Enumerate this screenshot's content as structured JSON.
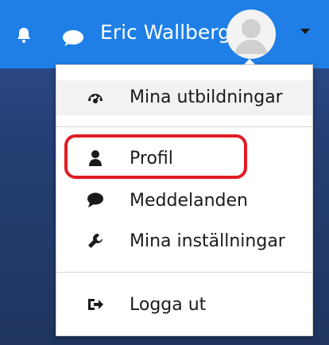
{
  "header": {
    "user_name": "Eric Wallberg",
    "icons": {
      "notifications": "bell-icon",
      "messages": "chat-icon",
      "avatar": "user-avatar-icon",
      "dropdown": "caret-down-icon"
    }
  },
  "menu": {
    "items": [
      {
        "label": "Mina utbildningar",
        "icon": "dashboard-icon"
      },
      {
        "label": "Profil",
        "icon": "user-icon"
      },
      {
        "label": "Meddelanden",
        "icon": "speech-bubble-icon"
      },
      {
        "label": "Mina inställningar",
        "icon": "wrench-icon"
      },
      {
        "label": "Logga ut",
        "icon": "sign-out-icon"
      }
    ],
    "highlight_color": "#e01b24"
  },
  "colors": {
    "navbar": "#1f7fe6",
    "menu_bg": "#ffffff",
    "text": "#1a1a1a"
  }
}
